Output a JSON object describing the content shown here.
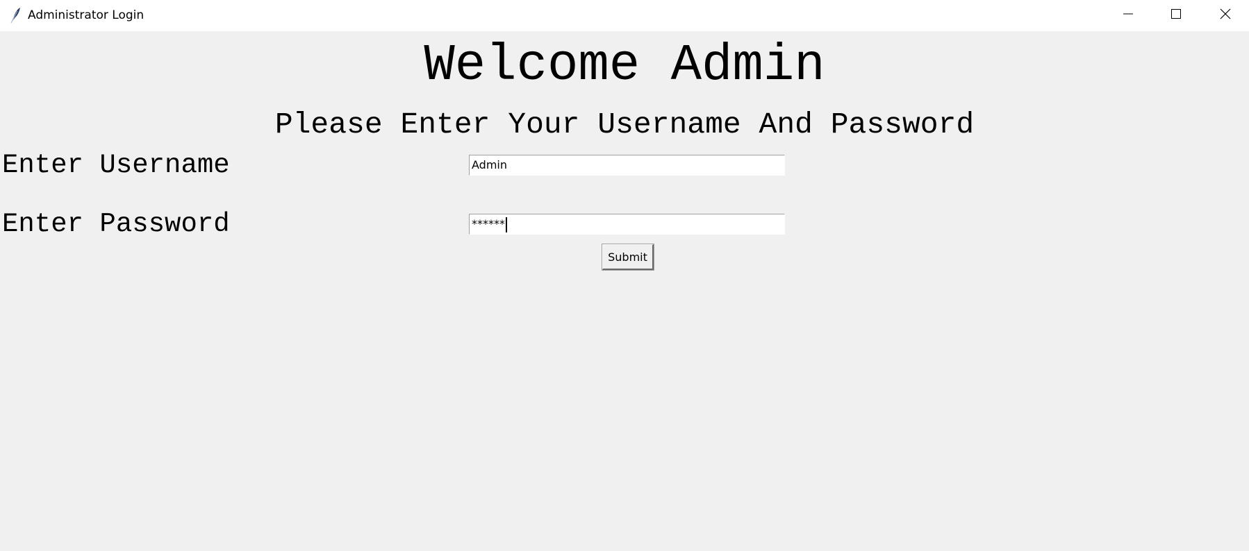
{
  "window": {
    "title": "Administrator Login",
    "icon": "feather-icon",
    "controls": {
      "minimize": "minimize-icon",
      "maximize": "maximize-icon",
      "close": "close-icon"
    }
  },
  "main": {
    "heading": "Welcome Admin",
    "subheading": "Please Enter Your Username And Password"
  },
  "form": {
    "username_label": "Enter Username",
    "username_value": "Admin",
    "password_label": "Enter Password",
    "password_value": "******",
    "submit_label": "Submit"
  }
}
